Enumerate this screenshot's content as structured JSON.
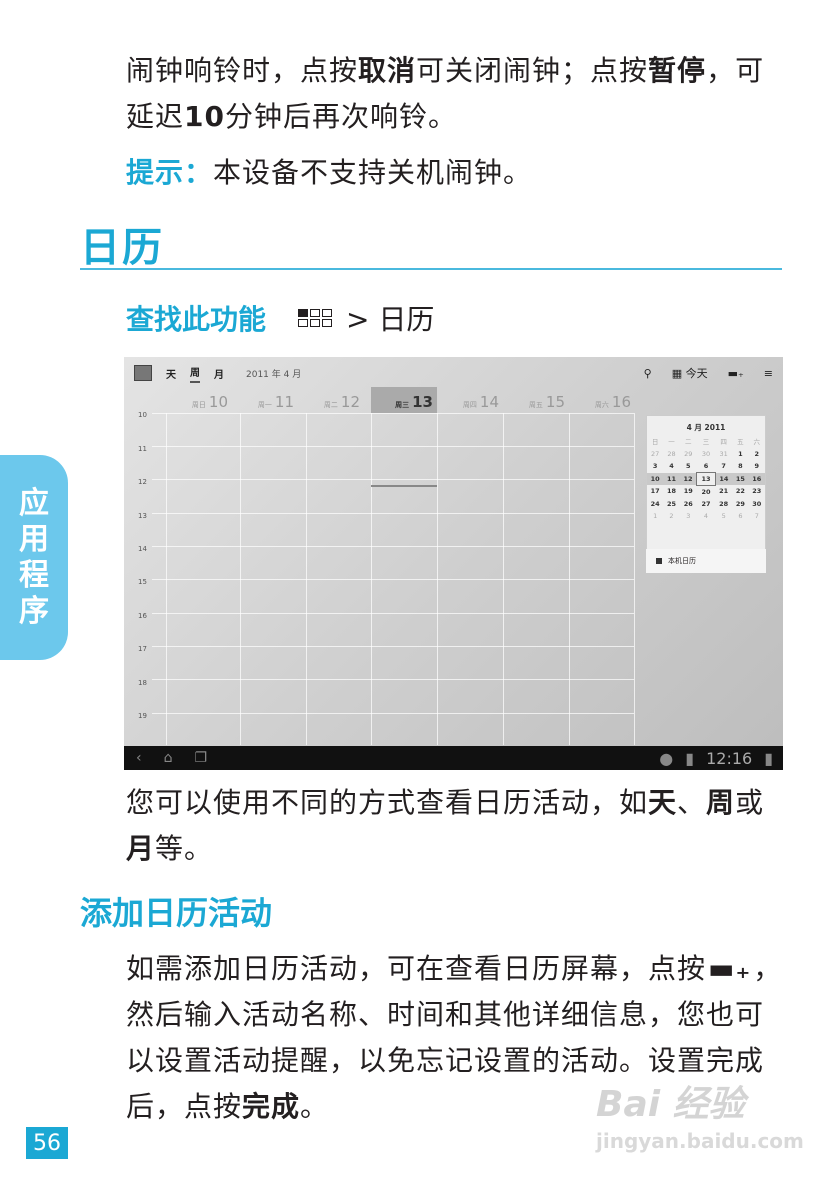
{
  "paragraph1": {
    "a": "闹钟响铃时，点按",
    "b1": "取消",
    "c": "可关闭闹钟；点按",
    "b2": "暂停",
    "d": "，可延迟",
    "b3": "10",
    "e": "分钟后再次响铃。"
  },
  "tip": {
    "label": "提示：",
    "text": "本设备不支持关机闹钟。"
  },
  "section_title": "日历",
  "find": {
    "label": "查找此功能",
    "path": "> 日历"
  },
  "side_tab": [
    "应",
    "用",
    "程",
    "序"
  ],
  "screenshot": {
    "tabs": [
      "天",
      "周",
      "月"
    ],
    "month_label": "2011 年 4 月",
    "today_button": "今天",
    "days": [
      {
        "name": "周日",
        "num": "10"
      },
      {
        "name": "周一",
        "num": "11"
      },
      {
        "name": "周二",
        "num": "12"
      },
      {
        "name": "周三",
        "num": "13"
      },
      {
        "name": "周四",
        "num": "14"
      },
      {
        "name": "周五",
        "num": "15"
      },
      {
        "name": "周六",
        "num": "16"
      }
    ],
    "hours": [
      "10",
      "11",
      "12",
      "13",
      "14",
      "15",
      "16",
      "17",
      "18",
      "19"
    ],
    "mini_cal": {
      "title": "4 月 2011",
      "weekdays": [
        "日",
        "一",
        "二",
        "三",
        "四",
        "五",
        "六"
      ],
      "rows": [
        [
          "27",
          "28",
          "29",
          "30",
          "31",
          "1",
          "2"
        ],
        [
          "3",
          "4",
          "5",
          "6",
          "7",
          "8",
          "9"
        ],
        [
          "10",
          "11",
          "12",
          "13",
          "14",
          "15",
          "16"
        ],
        [
          "17",
          "18",
          "19",
          "20",
          "21",
          "22",
          "23"
        ],
        [
          "24",
          "25",
          "26",
          "27",
          "28",
          "29",
          "30"
        ],
        [
          "1",
          "2",
          "3",
          "4",
          "5",
          "6",
          "7"
        ]
      ]
    },
    "my_calendar": "本机日历",
    "clock": "12:16"
  },
  "paragraph2": {
    "a": "您可以使用不同的方式查看日历活动，如",
    "b1": "天",
    "c": "、",
    "b2": "周",
    "d": "或",
    "b3": "月",
    "e": "等。"
  },
  "subsection_title": "添加日历活动",
  "paragraph3": {
    "a": "如需添加日历活动，可在查看日历屏幕，点按",
    "b": "，然后输入活动名称、时间和其他详细信息，您也可以设置活动提醒，以免忘记设置的活动。设置完成后，点按",
    "c": "完成",
    "d": "。"
  },
  "page_number": "56",
  "watermark": {
    "line1": "Bai 经验",
    "line2": "jingyan.baidu.com"
  }
}
